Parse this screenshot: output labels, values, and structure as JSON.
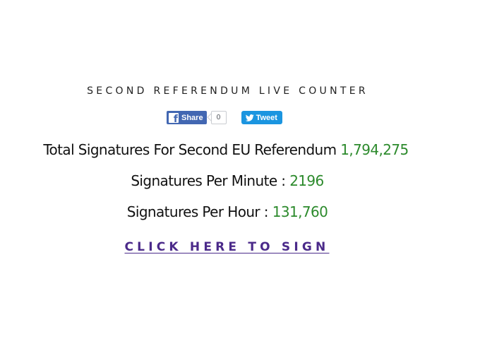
{
  "header": {
    "title": "SECOND REFERENDUM LIVE COUNTER"
  },
  "social": {
    "facebook_icon": "f",
    "share_label": "Share",
    "share_count": "0",
    "tweet_label": "Tweet",
    "facebook_color": "#4267b2",
    "twitter_color": "#1b95e0",
    "facebook_icon_name": "facebook-icon",
    "twitter_icon_name": "twitter-bird-icon"
  },
  "stats": {
    "total_label": "Total Signatures For Second EU Referendum",
    "total_value": "1,794,275",
    "minute_label": "Signatures Per Minute :",
    "minute_value": "2196",
    "hour_label": "Signatures Per Hour :",
    "hour_value": "131,760",
    "value_color": "#2c8a2c"
  },
  "cta": {
    "label": "CLICK HERE TO SIGN",
    "link_color": "#4b2a8a"
  }
}
